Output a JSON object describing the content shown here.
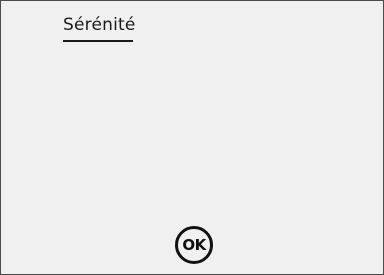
{
  "screen": {
    "title": "Sérénité",
    "ok_label": "OK"
  },
  "colors": {
    "background": "#f0f0f0",
    "border": "#4a4a4a",
    "text": "#1a1a1a"
  }
}
